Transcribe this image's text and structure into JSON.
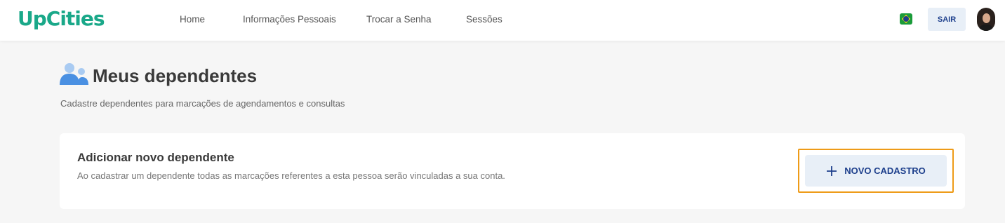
{
  "header": {
    "logo": "UpCities",
    "nav": [
      {
        "label": "Home"
      },
      {
        "label": "Informações Pessoais"
      },
      {
        "label": "Trocar a Senha"
      },
      {
        "label": "Sessões"
      }
    ],
    "language_icon": "brazil-flag-icon",
    "logout_label": "SAIR"
  },
  "main": {
    "title_icon": "users-icon",
    "title": "Meus dependentes",
    "subtitle": "Cadastre dependentes para marcações de agendamentos e consultas",
    "card": {
      "title": "Adicionar novo dependente",
      "description": "Ao cadastrar um dependente todas as marcações referentes a esta pessoa serão vinculadas a sua conta.",
      "button_icon": "plus-icon",
      "button_label": "NOVO CADASTRO"
    }
  },
  "colors": {
    "brand": "#1aa889",
    "primary_text": "#1d3f8c",
    "button_bg": "#e8eff7",
    "focus": "#ee9b18",
    "icon_blue": "#4a90e2"
  }
}
